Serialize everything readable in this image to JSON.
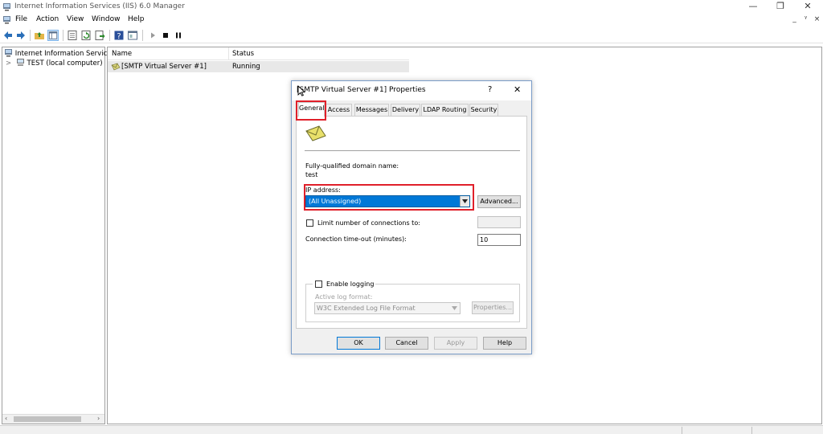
{
  "window": {
    "title": "Internet Information Services (IIS) 6.0 Manager",
    "minimize_glyph": "—",
    "restore_glyph": "❐",
    "close_glyph": "✕"
  },
  "menu": {
    "items": [
      "File",
      "Action",
      "View",
      "Window",
      "Help"
    ],
    "mdi_minimize": "_",
    "mdi_restore": "ᵞ",
    "mdi_close": "×"
  },
  "tree": {
    "root_label": "Internet Information Service",
    "child_label": "TEST (local computer)",
    "expander": ">"
  },
  "list": {
    "columns": [
      "Name",
      "Status"
    ],
    "rows": [
      {
        "name": "[SMTP Virtual Server #1]",
        "status": "Running"
      }
    ]
  },
  "dialog": {
    "title": "[SMTP Virtual Server #1] Properties",
    "help_glyph": "?",
    "close_glyph": "✕",
    "tabs": [
      "General",
      "Access",
      "Messages",
      "Delivery",
      "LDAP Routing",
      "Security"
    ],
    "active_tab": "General",
    "fqdn_label": "Fully-qualified domain name:",
    "fqdn_value": "test",
    "ip_label": "IP address:",
    "ip_value": "(All Unassigned)",
    "advanced_button": "Advanced...",
    "limit_connections_label": "Limit number of connections to:",
    "limit_connections_value": "",
    "timeout_label": "Connection time-out (minutes):",
    "timeout_value": "10",
    "enable_logging_label": "Enable logging",
    "log_format_label": "Active log format:",
    "log_format_value": "W3C Extended Log File Format",
    "log_properties_button": "Properties...",
    "ok_button": "OK",
    "cancel_button": "Cancel",
    "apply_button": "Apply",
    "help_button": "Help"
  },
  "colors": {
    "selection_blue": "#0078d7",
    "highlight_red": "#e0202a",
    "dialog_bg": "#f0f0f0"
  }
}
